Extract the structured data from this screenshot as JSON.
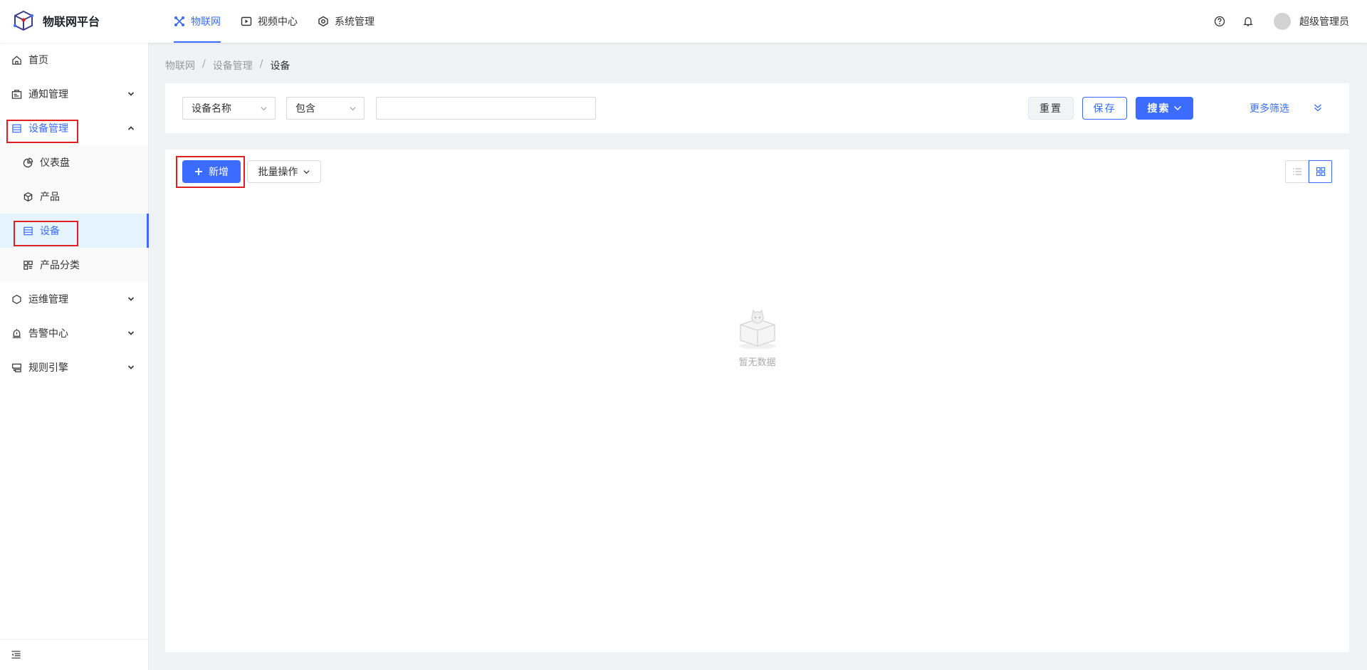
{
  "app": {
    "title": "物联网平台",
    "brand_color": "#3b6cff"
  },
  "topnav": {
    "items": [
      {
        "label": "物联网",
        "icon": "iot-icon",
        "active": true
      },
      {
        "label": "视频中心",
        "icon": "video-icon"
      },
      {
        "label": "系统管理",
        "icon": "system-icon"
      }
    ]
  },
  "header": {
    "username": "超级管理员"
  },
  "sidebar": {
    "items": [
      {
        "label": "首页",
        "icon": "home-icon"
      },
      {
        "label": "通知管理",
        "icon": "notice-icon"
      },
      {
        "label": "设备管理",
        "icon": "device-manage-icon",
        "expanded": true,
        "children": [
          {
            "label": "仪表盘",
            "icon": "dashboard-icon"
          },
          {
            "label": "产品",
            "icon": "product-icon"
          },
          {
            "label": "设备",
            "icon": "device-icon",
            "selected": true
          },
          {
            "label": "产品分类",
            "icon": "category-icon"
          }
        ]
      },
      {
        "label": "运维管理",
        "icon": "ops-icon"
      },
      {
        "label": "告警中心",
        "icon": "alarm-icon"
      },
      {
        "label": "规则引擎",
        "icon": "rule-icon"
      }
    ]
  },
  "breadcrumb": {
    "items": [
      "物联网",
      "设备管理",
      "设备"
    ]
  },
  "filter": {
    "field_select": "设备名称",
    "operator_select": "包含",
    "value_input": "",
    "reset_label": "重置",
    "save_label": "保存",
    "search_label": "搜索",
    "more_label": "更多筛选"
  },
  "toolbar": {
    "add_label": "新增",
    "batch_label": "批量操作"
  },
  "empty": {
    "text": "暂无数据"
  }
}
